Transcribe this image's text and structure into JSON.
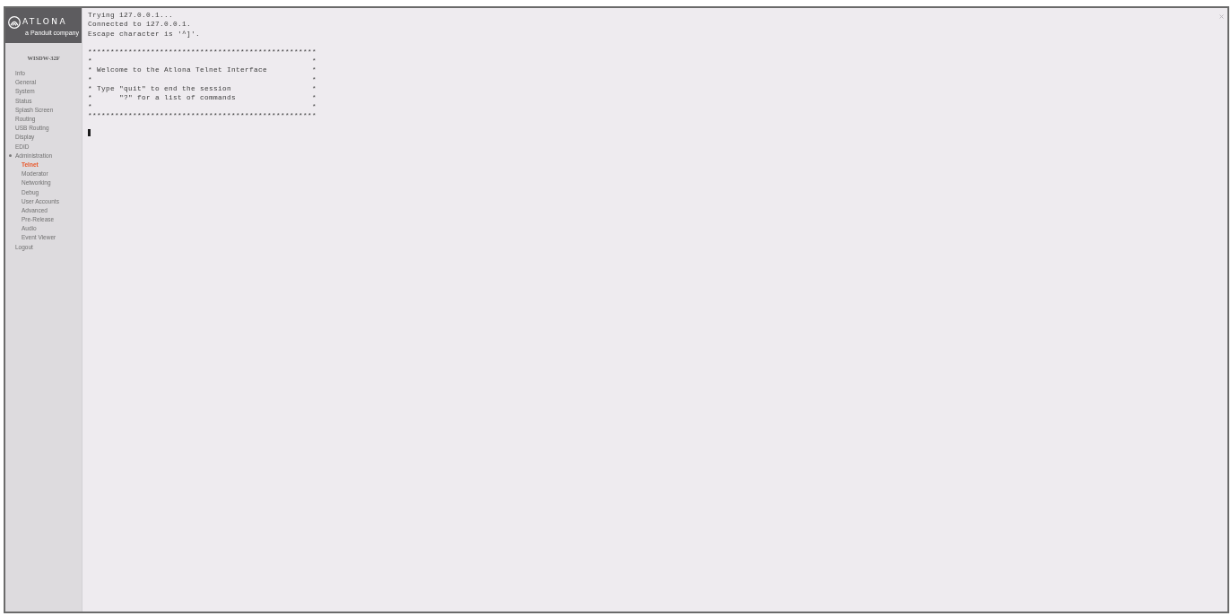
{
  "sidebar": {
    "logo": {
      "wordmark": "ATLONA",
      "tagline": "a Panduit company"
    },
    "device_name": "WISDW-32F",
    "items": [
      {
        "label": "Info",
        "selected": false,
        "expanded": false
      },
      {
        "label": "General",
        "selected": false,
        "expanded": false
      },
      {
        "label": "System",
        "selected": false,
        "expanded": false
      },
      {
        "label": "Status",
        "selected": false,
        "expanded": false
      },
      {
        "label": "Splash Screen",
        "selected": false,
        "expanded": false
      },
      {
        "label": "Routing",
        "selected": false,
        "expanded": false
      },
      {
        "label": "USB Routing",
        "selected": false,
        "expanded": false
      },
      {
        "label": "Display",
        "selected": false,
        "expanded": false
      },
      {
        "label": "EDID",
        "selected": false,
        "expanded": false
      },
      {
        "label": "Administration",
        "selected": false,
        "expanded": true,
        "children": [
          {
            "label": "Telnet",
            "selected": true
          },
          {
            "label": "Moderator",
            "selected": false
          },
          {
            "label": "Networking",
            "selected": false
          },
          {
            "label": "Debug",
            "selected": false
          },
          {
            "label": "User Accounts",
            "selected": false
          },
          {
            "label": "Advanced",
            "selected": false
          },
          {
            "label": "Pre-Release",
            "selected": false
          },
          {
            "label": "Audio",
            "selected": false
          },
          {
            "label": "Event Viewer",
            "selected": false
          }
        ]
      },
      {
        "label": "Logout",
        "selected": false,
        "expanded": false
      }
    ]
  },
  "terminal": {
    "session_lines": [
      "Trying 127.0.0.1...",
      "Connected to 127.0.0.1.",
      "Escape character is '^]'."
    ],
    "welcome_text": "***************************************************\n*                                                 *\n* Welcome to the Atlona Telnet Interface          *\n*                                                 *\n* Type \"quit\" to end the session                  *\n*      \"?\" for a list of commands                 *\n*                                                 *\n***************************************************"
  }
}
